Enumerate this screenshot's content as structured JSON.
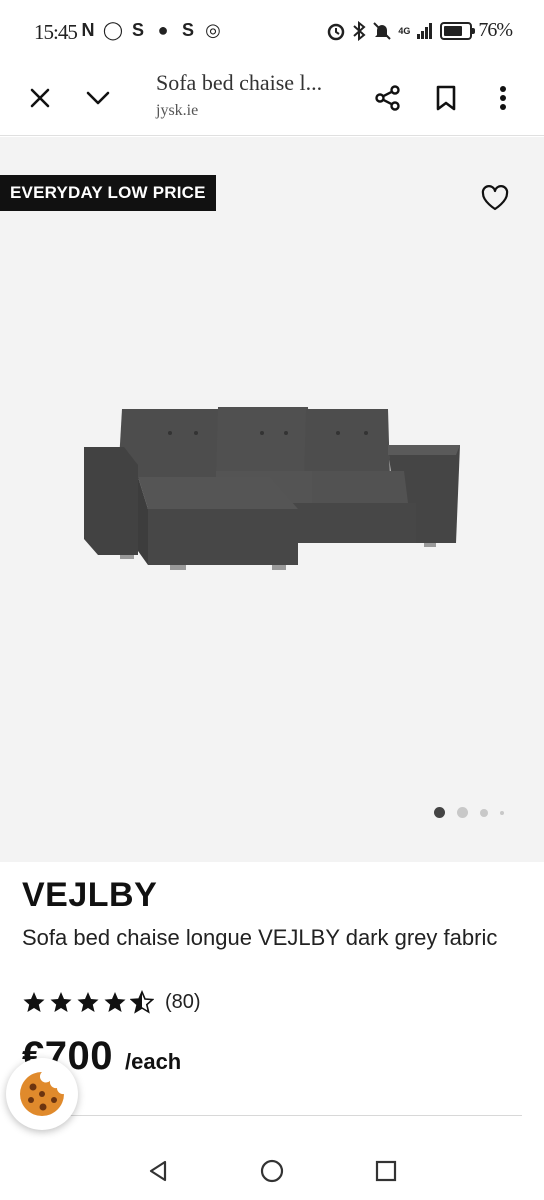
{
  "status_bar": {
    "time": "15:45",
    "left_icons": [
      "nfc-icon",
      "whatsapp-icon",
      "s-app-icon",
      "chat-icon",
      "s-app-icon",
      "instagram-icon"
    ],
    "left_glyphs": [
      "N",
      "◯",
      "S",
      "●",
      "S",
      "◎"
    ],
    "network": "4G",
    "battery": "76%",
    "battery_level": 0.76
  },
  "toolbar": {
    "page_title": "Sofa bed chaise l...",
    "domain": "jysk.ie"
  },
  "gallery": {
    "badge": "EVERYDAY LOW PRICE",
    "slide_count": 4,
    "active_slide": 1
  },
  "product": {
    "brand": "VEJLBY",
    "description": "Sofa bed chaise longue VEJLBY dark grey fabric",
    "rating": 4.5,
    "rating_count": "(80)",
    "price": "€700",
    "price_unit": "/each"
  },
  "colors": {
    "badge_bg": "#111111",
    "gallery_bg": "#f3f3f3",
    "sofa": "#4a4a4a"
  }
}
